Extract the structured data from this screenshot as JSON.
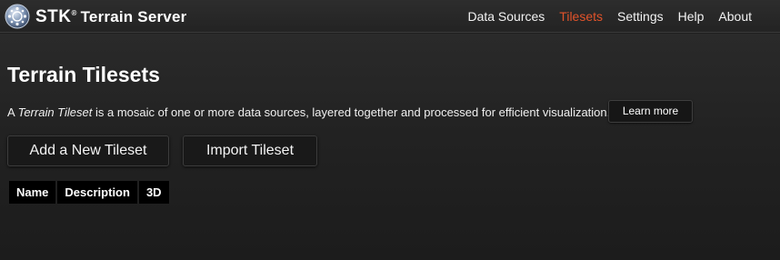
{
  "app": {
    "brand_stk": "STK",
    "brand_tm": "®",
    "brand_name": "Terrain Server"
  },
  "nav": {
    "items": [
      {
        "label": "Data Sources",
        "active": false
      },
      {
        "label": "Tilesets",
        "active": true
      },
      {
        "label": "Settings",
        "active": false
      },
      {
        "label": "Help",
        "active": false
      },
      {
        "label": "About",
        "active": false
      }
    ]
  },
  "page": {
    "title": "Terrain Tilesets",
    "intro_prefix": "A ",
    "intro_em": "Terrain Tileset",
    "intro_suffix": " is a mosaic of one or more data sources, layered together and processed for efficient visualization.",
    "learn_more_label": "Learn more",
    "add_button_label": "Add a New Tileset",
    "import_button_label": "Import Tileset"
  },
  "table": {
    "columns": [
      "Name",
      "Description",
      "3D"
    ]
  },
  "colors": {
    "accent": "#e2532a",
    "background": "#1f1f1f",
    "header_bg": "#000000"
  }
}
